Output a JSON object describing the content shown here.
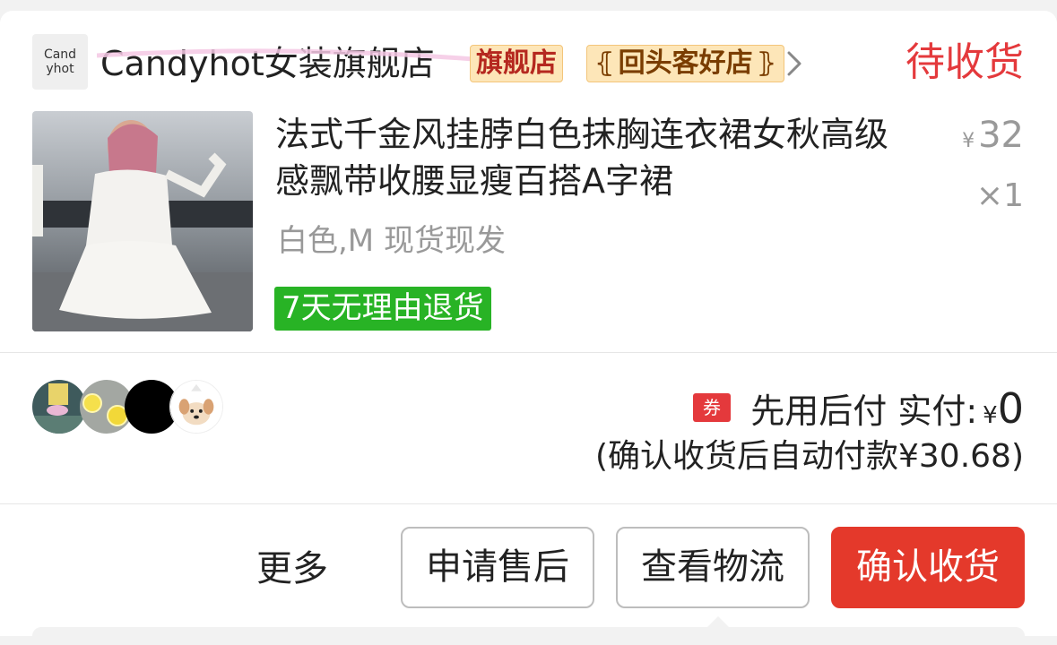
{
  "shop": {
    "logo_line1": "Cand",
    "logo_line2": "yhot",
    "name": "Candyhot女装旗舰店",
    "tag_flagship": "旗舰店",
    "tag_repeat": "回头客好店",
    "status": "待收货"
  },
  "product": {
    "title": "法式千金风挂脖白色抹胸连衣裙女秋高级感飘带收腰显瘦百搭A字裙",
    "spec": "白色,M 现货现发",
    "price_currency": "¥",
    "price": "32",
    "quantity": "×1",
    "return_badge": "7天无理由退货"
  },
  "payment": {
    "coupon_label": "券",
    "pay_label": "先用后付 实付:",
    "currency": "¥",
    "amount": "0",
    "note": "(确认收货后自动付款¥30.68)"
  },
  "actions": {
    "more": "更多",
    "after_sale": "申请售后",
    "logistics": "查看物流",
    "confirm": "确认收货"
  },
  "colors": {
    "accent_red": "#e4393c",
    "badge_green": "#28b325"
  }
}
